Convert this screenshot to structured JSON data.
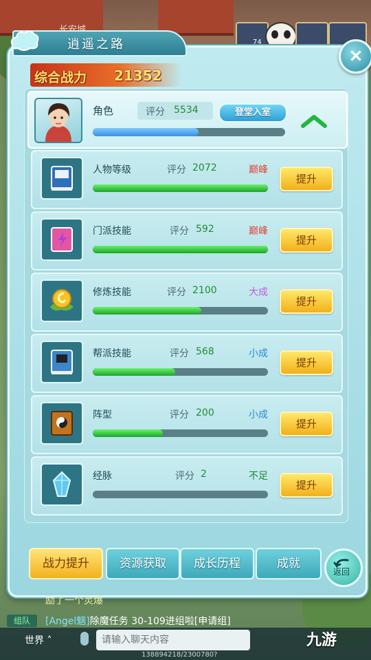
{
  "scene": {
    "city_name": "长安城",
    "player_level": "74"
  },
  "panel": {
    "title": "逍遥之路",
    "close_icon": "×",
    "power_label": "综合战力",
    "power_value": "21352"
  },
  "role": {
    "name": "角色",
    "score_label": "评分",
    "score_value": "5534",
    "tier": "登堂入室",
    "progress": 0.55
  },
  "rows": [
    {
      "name": "人物等级",
      "score_label": "评分",
      "score": "2072",
      "rank": "巅峰",
      "rank_color": "#e0463a",
      "progress": 1.0,
      "button": "提升",
      "icon": "character-book-icon"
    },
    {
      "name": "门派技能",
      "score_label": "评分",
      "score": "592",
      "rank": "巅峰",
      "rank_color": "#e0463a",
      "progress": 1.0,
      "button": "提升",
      "icon": "skill-book-icon"
    },
    {
      "name": "修炼技能",
      "score_label": "评分",
      "score": "2100",
      "rank": "大成",
      "rank_color": "#c55ad9",
      "progress": 0.62,
      "button": "提升",
      "icon": "golden-orb-icon"
    },
    {
      "name": "帮派技能",
      "score_label": "评分",
      "score": "568",
      "rank": "小成",
      "rank_color": "#2d8bd6",
      "progress": 0.47,
      "button": "提升",
      "icon": "guild-book-icon"
    },
    {
      "name": "阵型",
      "score_label": "评分",
      "score": "200",
      "rank": "小成",
      "rank_color": "#2d8bd6",
      "progress": 0.4,
      "button": "提升",
      "icon": "formation-book-icon"
    },
    {
      "name": "经脉",
      "score_label": "评分",
      "score": "2",
      "rank": "不足",
      "rank_color": "#1f8c33",
      "progress": 0.0,
      "button": "提升",
      "icon": "blue-crystal-icon"
    }
  ],
  "tabs": [
    "战力提升",
    "资源获取",
    "成长历程",
    "成就"
  ],
  "back_label": "返回",
  "chat": {
    "line1": "励了一个灵爆",
    "team_badge": "组队",
    "line2_name": "[Angel魑]",
    "line2_text": "除魔任务 30-109进组啦[申请组]",
    "channel": "世界",
    "input_placeholder": "请输入聊天内容",
    "coords": "138894218/2300780?"
  },
  "watermark": "九游"
}
